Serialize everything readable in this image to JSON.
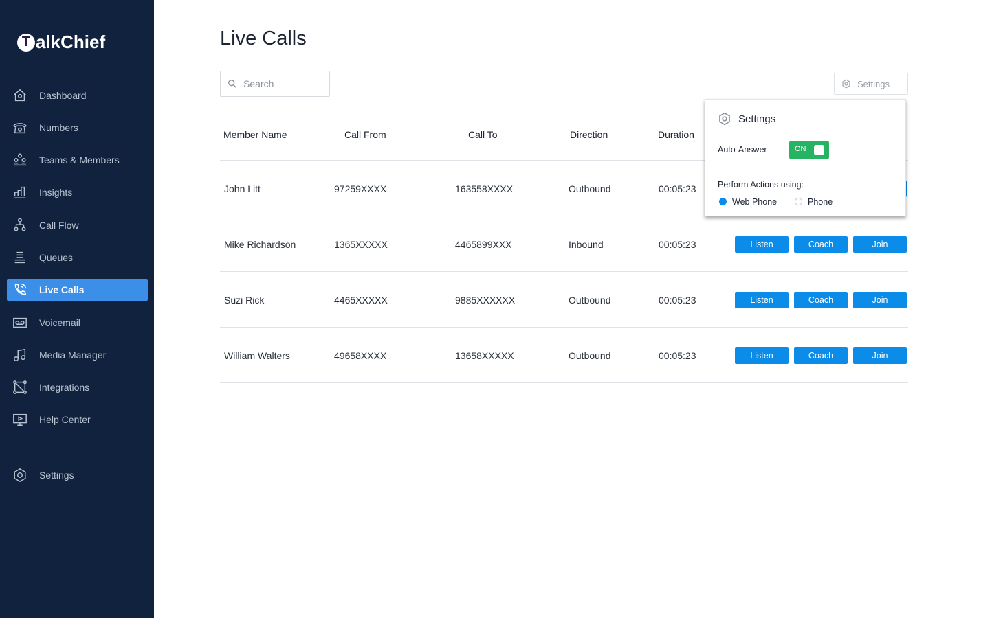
{
  "brand": {
    "logo_letter": "T",
    "logo_rest": "alkChief"
  },
  "sidebar": {
    "items": [
      {
        "label": "Dashboard",
        "icon": "home-icon"
      },
      {
        "label": "Numbers",
        "icon": "telephone-icon"
      },
      {
        "label": "Teams & Members",
        "icon": "team-icon"
      },
      {
        "label": "Insights",
        "icon": "bar-chart-icon"
      },
      {
        "label": "Call Flow",
        "icon": "flow-icon"
      },
      {
        "label": "Queues",
        "icon": "queue-icon"
      },
      {
        "label": "Live Calls",
        "icon": "phone-call-icon",
        "active": true
      },
      {
        "label": "Voicemail",
        "icon": "voicemail-icon"
      },
      {
        "label": "Media Manager",
        "icon": "music-icon"
      },
      {
        "label": "Integrations",
        "icon": "integrations-icon"
      },
      {
        "label": "Help Center",
        "icon": "monitor-play-icon"
      }
    ],
    "settings": "Settings"
  },
  "page": {
    "title": "Live Calls",
    "search_placeholder": "Search",
    "settings_button": "Settings"
  },
  "table": {
    "columns": [
      "Member Name",
      "Call From",
      "Call To",
      "Direction",
      "Duration"
    ],
    "rows": [
      {
        "name": "John Litt",
        "from": "97259XXXX",
        "to": "163558XXXX",
        "direction": "Outbound",
        "duration": "00:05:23"
      },
      {
        "name": "Mike Richardson",
        "from": "1365XXXXX",
        "to": "4465899XXX",
        "direction": "Inbound",
        "duration": "00:05:23"
      },
      {
        "name": "Suzi Rick",
        "from": "4465XXXXX",
        "to": "9885XXXXXX",
        "direction": "Outbound",
        "duration": "00:05:23"
      },
      {
        "name": "William Walters",
        "from": "49658XXXX",
        "to": "13658XXXXX",
        "direction": "Outbound",
        "duration": "00:05:23"
      }
    ],
    "actions": [
      "Listen",
      "Coach",
      "Join"
    ]
  },
  "popup": {
    "title": "Settings",
    "auto_answer_label": "Auto-Answer",
    "auto_answer_state": "ON",
    "auto_answer_on": true,
    "perform_label": "Perform Actions using:",
    "options": [
      "Web Phone",
      "Phone"
    ],
    "selected": "Web Phone"
  },
  "colors": {
    "sidebar": "#10223d",
    "active": "#3b8fe8",
    "button": "#0c8ce9",
    "toggle": "#27b462"
  }
}
